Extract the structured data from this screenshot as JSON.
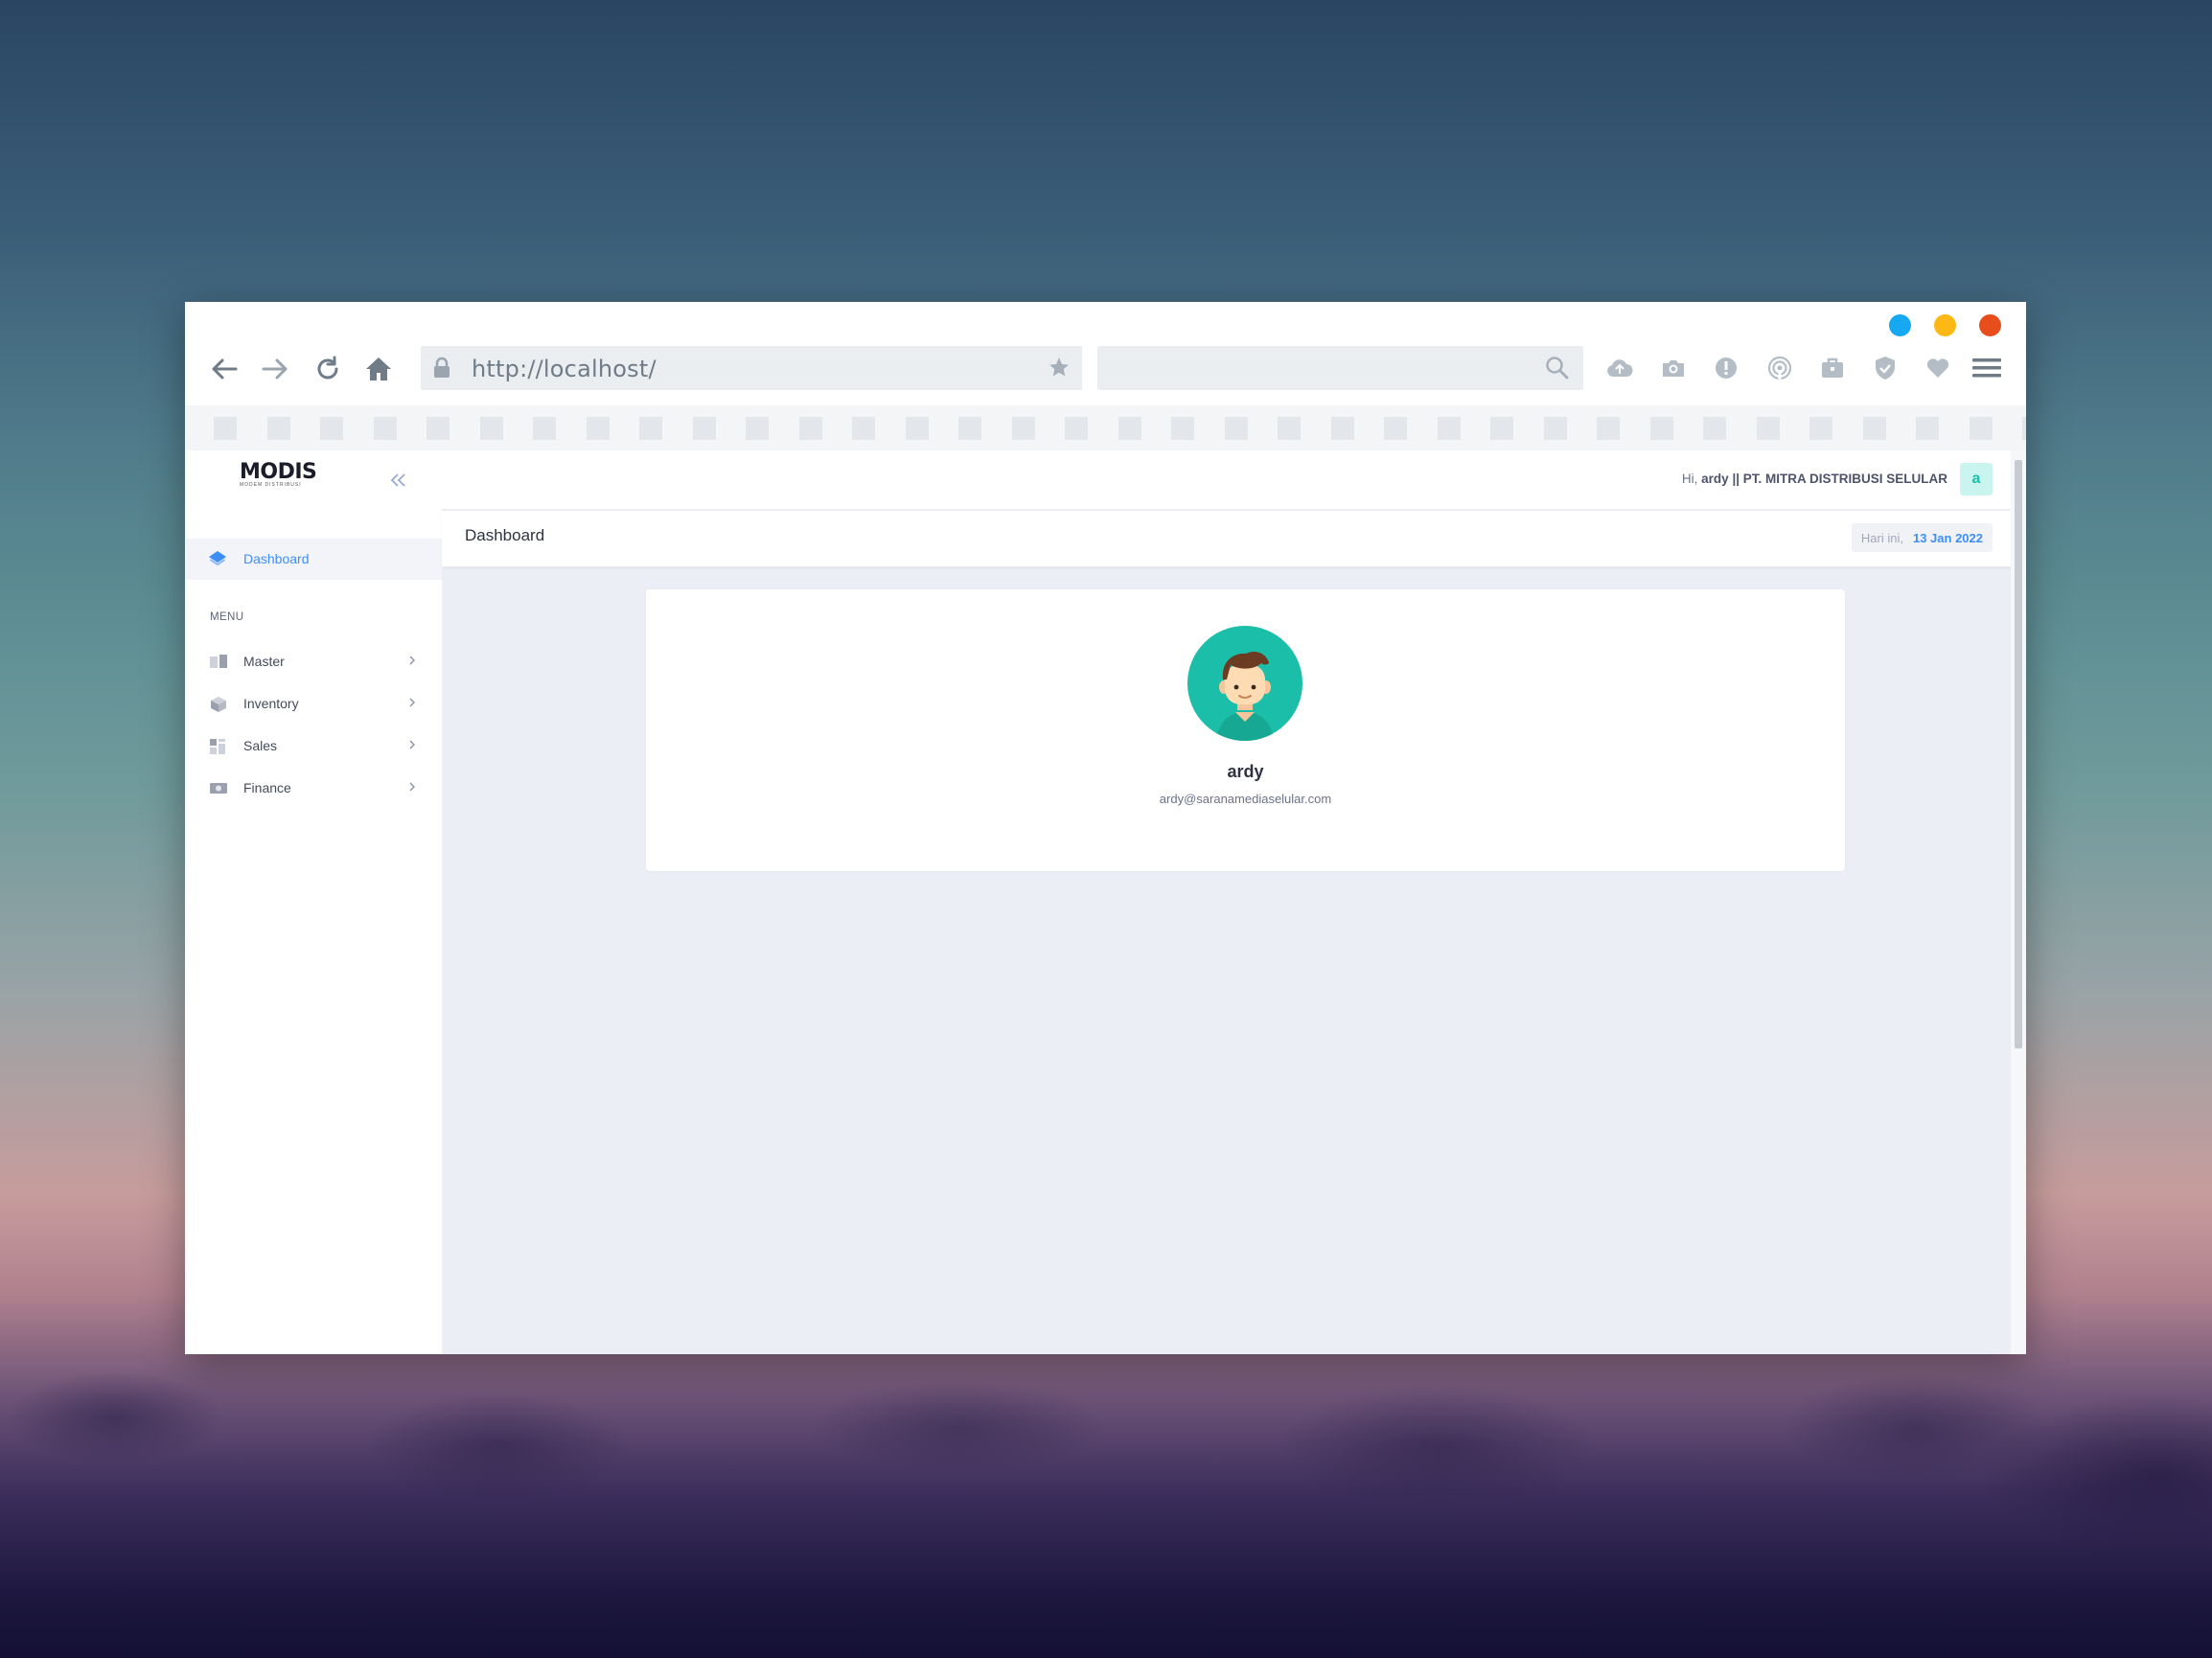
{
  "colors": {
    "traffic_blue": "#16a8f0",
    "traffic_yellow": "#fdb813",
    "traffic_red": "#e84d1c",
    "accent": "#3e8ef7",
    "teal": "#1bbfa9"
  },
  "browser": {
    "url": "http://localhost/",
    "search_value": "",
    "icons": [
      "back-icon",
      "forward-icon",
      "reload-icon",
      "home-icon",
      "lock-icon",
      "star-icon",
      "search-icon",
      "cloud-upload-icon",
      "camera-icon",
      "alert-icon",
      "broadcast-icon",
      "briefcase-icon",
      "shield-icon",
      "heart-icon",
      "hamburger-icon"
    ]
  },
  "sidebar": {
    "logo_text": "MODIS",
    "logo_sub": "MODEM DISTRIBUSI",
    "active": {
      "label": "Dashboard",
      "icon": "layers-icon"
    },
    "menu_header": "MENU",
    "items": [
      {
        "label": "Master",
        "icon": "book-icon"
      },
      {
        "label": "Inventory",
        "icon": "box-icon"
      },
      {
        "label": "Sales",
        "icon": "grid-icon"
      },
      {
        "label": "Finance",
        "icon": "money-icon"
      }
    ]
  },
  "topbar": {
    "greeting_prefix": "Hi,",
    "greeting_user": "ardy || PT. MITRA DISTRIBUSI SELULAR",
    "avatar_letter": "a"
  },
  "subheader": {
    "title": "Dashboard",
    "date_prefix": "Hari ini,",
    "date_value": "13 Jan 2022"
  },
  "profile": {
    "name": "ardy",
    "email": "ardy@saranamediaselular.com"
  }
}
